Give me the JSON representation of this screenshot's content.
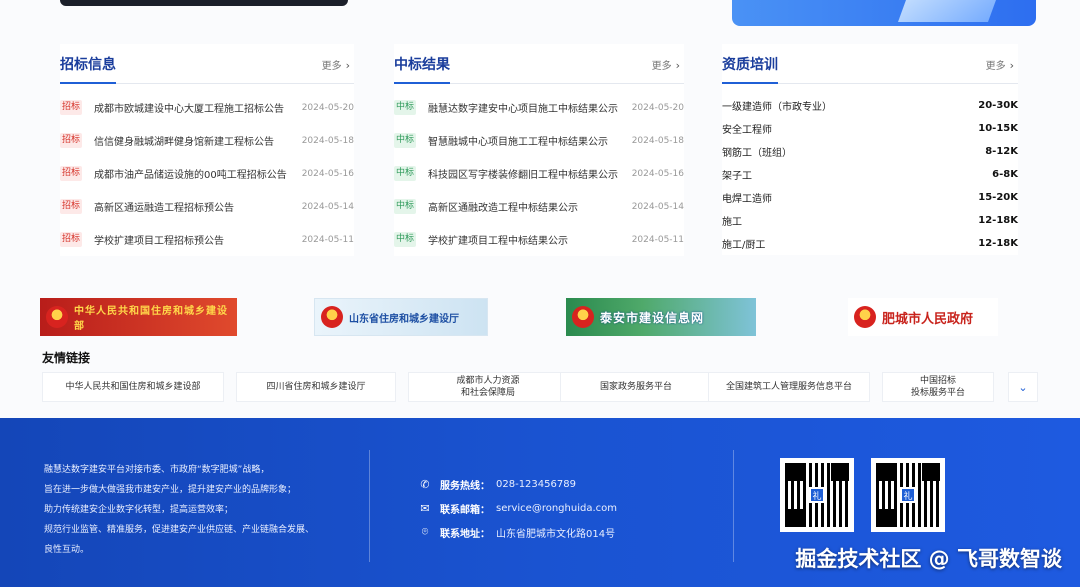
{
  "bidding": {
    "title": "招标信息",
    "more": "更多",
    "items": [
      {
        "tag": "招标",
        "text": "成都市欧城建设中心大厦工程施工招标公告",
        "date": "2024-05-20"
      },
      {
        "tag": "招标",
        "text": "信信健身融城湖畔健身馆新建工程标公告",
        "date": "2024-05-18"
      },
      {
        "tag": "招标",
        "text": "成都市油产品储运设施的00吨工程招标公告",
        "date": "2024-05-16"
      },
      {
        "tag": "招标",
        "text": "高新区通运融造工程招标预公告",
        "date": "2024-05-14"
      },
      {
        "tag": "招标",
        "text": "学校扩建项目工程招标预公告",
        "date": "2024-05-11"
      }
    ]
  },
  "results": {
    "title": "中标结果",
    "more": "更多",
    "items": [
      {
        "tag": "中标",
        "text": "融慧达数字建安中心项目施工中标结果公示",
        "date": "2024-05-20"
      },
      {
        "tag": "中标",
        "text": "智慧融城中心项目施工工程中标结果公示",
        "date": "2024-05-18"
      },
      {
        "tag": "中标",
        "text": "科技园区写字楼装修翻旧工程中标结果公示",
        "date": "2024-05-16"
      },
      {
        "tag": "中标",
        "text": "高新区通融改造工程中标结果公示",
        "date": "2024-05-14"
      },
      {
        "tag": "中标",
        "text": "学校扩建项目工程中标结果公示",
        "date": "2024-05-11"
      }
    ]
  },
  "training": {
    "title": "资质培训",
    "more": "更多",
    "items": [
      {
        "name": "一级建造师（市政专业）",
        "salary": "20-30K"
      },
      {
        "name": "安全工程师",
        "salary": "10-15K"
      },
      {
        "name": "钢筋工（班组）",
        "salary": "8-12K"
      },
      {
        "name": "架子工",
        "salary": "6-8K"
      },
      {
        "name": "电焊工造师",
        "salary": "15-20K"
      },
      {
        "name": "施工",
        "salary": "12-18K"
      },
      {
        "name": "施工/厨工",
        "salary": "12-18K"
      }
    ]
  },
  "logos": {
    "logo1": "中华人民共和国住房和城乡建设部",
    "logo2": "山东省住房和城乡建设厅",
    "logo3": "泰安市建设信息网",
    "logo4": "肥城市人民政府"
  },
  "friend_links": {
    "title": "友情链接",
    "items": [
      "中华人民共和国住房和城乡建设部",
      "四川省住房和城乡建设厅",
      "成都市人力资源\n和社会保障局",
      "国家政务服务平台",
      "全国建筑工人管理服务信息平台",
      "中国招标\n投标服务平台"
    ]
  },
  "footer": {
    "intro": [
      "融慧达数字建安平台对接市委、市政府“数字肥城”战略，",
      "旨在进一步做大做强我市建安产业，提升建安产业的品牌形象；",
      "助力传统建安企业数字化转型，提高运营效率；",
      "规范行业监管、精准服务，促进建安产业供应链、产业链融合发展、",
      "良性互动。"
    ],
    "hotline_label": "服务热线：",
    "hotline": "028-123456789",
    "email_label": "联系邮箱：",
    "email": "service@ronghuida.com",
    "address_label": "联系地址：",
    "address": "山东省肥城市文化路014号",
    "qr_mark": "礼"
  },
  "watermark": {
    "text": "掘金技术社区 @ 飞哥数智谈"
  }
}
